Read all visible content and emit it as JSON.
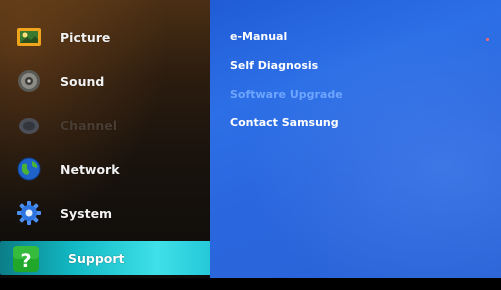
{
  "menu": {
    "items": [
      {
        "label": "Picture",
        "icon": "picture-icon"
      },
      {
        "label": "Sound",
        "icon": "sound-icon"
      },
      {
        "label": "Channel",
        "icon": "channel-icon",
        "state": "dimmed"
      },
      {
        "label": "Network",
        "icon": "globe-icon"
      },
      {
        "label": "System",
        "icon": "gear-icon"
      },
      {
        "label": "Support",
        "icon": "question-icon",
        "state": "selected"
      }
    ]
  },
  "submenu": {
    "items": [
      {
        "label": "e-Manual"
      },
      {
        "label": "Self Diagnosis"
      },
      {
        "label": "Software Upgrade",
        "state": "disabled"
      },
      {
        "label": "Contact Samsung"
      }
    ]
  },
  "colors": {
    "selected_highlight": "#3fe0e8",
    "submenu_background": "#2a66de",
    "disabled_text": "#6ea6ff"
  }
}
